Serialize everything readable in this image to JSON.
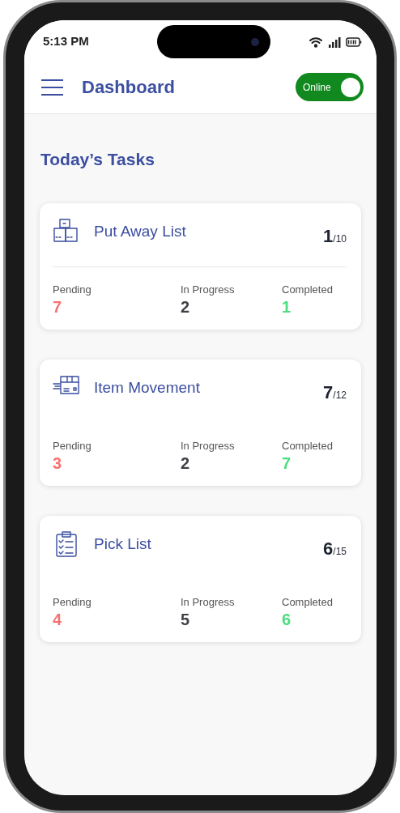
{
  "status_bar": {
    "time": "5:13 PM"
  },
  "header": {
    "title": "Dashboard",
    "status_toggle": {
      "label": "Online",
      "on": true
    }
  },
  "section_title": "Today’s Tasks",
  "tasks": [
    {
      "kind": "put_away",
      "title": "Put Away List",
      "done": "1",
      "total": "/10",
      "divider": true,
      "stats": [
        {
          "label": "Pending",
          "value": "7",
          "color": "#f87171"
        },
        {
          "label": "In Progress",
          "value": "2",
          "color": "#3f3f46"
        },
        {
          "label": "Completed",
          "value": "1",
          "color": "#4ade80"
        }
      ]
    },
    {
      "kind": "movement",
      "title": "Item Movement",
      "done": "7",
      "total": "/12",
      "divider": false,
      "stats": [
        {
          "label": "Pending",
          "value": "3",
          "color": "#f87171"
        },
        {
          "label": "In Progress",
          "value": "2",
          "color": "#3f3f46"
        },
        {
          "label": "Completed",
          "value": "7",
          "color": "#4ade80"
        }
      ]
    },
    {
      "kind": "pick",
      "title": "Pick List",
      "done": "6",
      "total": "/15",
      "divider": false,
      "stats": [
        {
          "label": "Pending",
          "value": "4",
          "color": "#f87171"
        },
        {
          "label": "In Progress",
          "value": "5",
          "color": "#3f3f46"
        },
        {
          "label": "Completed",
          "value": "6",
          "color": "#4ade80"
        }
      ]
    }
  ]
}
